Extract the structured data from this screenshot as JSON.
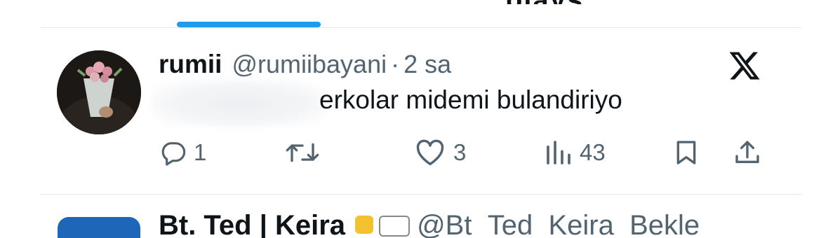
{
  "tabs": {
    "partial_label": "plays"
  },
  "tweet": {
    "display_name": "rumii",
    "handle": "@rumiibayani",
    "separator": "·",
    "time": "2 sa",
    "text": "erkolar midemi bulandiriyo",
    "actions": {
      "reply_count": "1",
      "retweet_count": "",
      "like_count": "3",
      "views_count": "43"
    }
  },
  "next_tweet": {
    "display_name": "Bt. Ted | Keira",
    "handle": "@Bt_Ted_Keira_Bekle"
  },
  "colors": {
    "accent": "#1d9bf0",
    "text": "#0f1419",
    "secondary": "#536471",
    "divider": "#e4e6e8"
  },
  "icons": [
    "reply-icon",
    "retweet-icon",
    "like-icon",
    "views-icon",
    "bookmark-icon",
    "share-icon",
    "x-logo-icon"
  ]
}
